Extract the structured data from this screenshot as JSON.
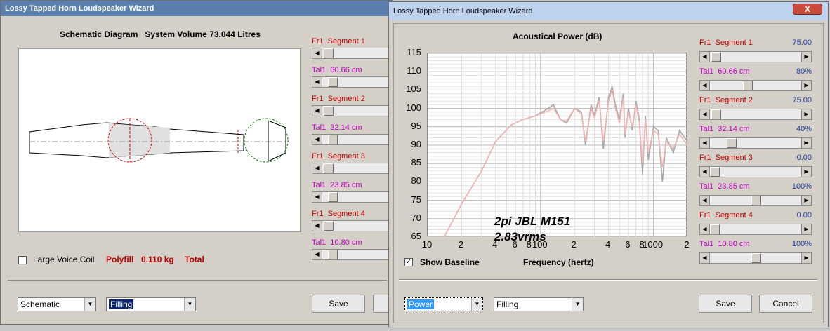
{
  "back": {
    "title": "Lossy Tapped Horn Loudspeaker Wizard",
    "schematic_heading": "Schematic Diagram   System Volume 73.044 Litres",
    "sliders": [
      {
        "label": "Fr1  Segment 1",
        "kind": "red"
      },
      {
        "label": "Tal1  60.66 cm",
        "kind": "mag"
      },
      {
        "label": "Fr1  Segment 2",
        "kind": "red"
      },
      {
        "label": "Tal1  32.14 cm",
        "kind": "mag"
      },
      {
        "label": "Fr1  Segment 3",
        "kind": "red"
      },
      {
        "label": "Tal1  23.85 cm",
        "kind": "mag"
      },
      {
        "label": "Fr1  Segment 4",
        "kind": "red"
      },
      {
        "label": "Tal1  10.80 cm",
        "kind": "mag"
      }
    ],
    "large_voice_coil": "Large Voice Coil",
    "polyfill": "Polyfill",
    "polyfill_value": "0.110 kg",
    "total": "Total",
    "select1": "Schematic",
    "select2": "Filling",
    "save": "Save"
  },
  "front": {
    "title": "Lossy Tapped Horn Loudspeaker Wizard",
    "close_symbol": "X",
    "sliders": [
      {
        "label": "Fr1  Segment 1",
        "value": "75.00",
        "kind": "red",
        "fraction": 0.02
      },
      {
        "label": "Tal1  60.66 cm",
        "value": "80%",
        "kind": "mag",
        "fraction": 0.4
      },
      {
        "label": "Fr1  Segment 2",
        "value": "75.00",
        "kind": "red",
        "fraction": 0.02
      },
      {
        "label": "Tal1  32.14 cm",
        "value": "40%",
        "kind": "mag",
        "fraction": 0.2
      },
      {
        "label": "Fr1  Segment 3",
        "value": "0.00",
        "kind": "red",
        "fraction": 0.0
      },
      {
        "label": "Tal1  23.85 cm",
        "value": "100%",
        "kind": "mag",
        "fraction": 0.5
      },
      {
        "label": "Fr1  Segment 4",
        "value": "0.00",
        "kind": "red",
        "fraction": 0.0
      },
      {
        "label": "Tal1  10.80 cm",
        "value": "100%",
        "kind": "mag",
        "fraction": 0.5
      }
    ],
    "show_baseline": "Show Baseline",
    "show_baseline_checked": true,
    "select1": "Power",
    "select2": "Filling",
    "save": "Save",
    "cancel": "Cancel"
  },
  "chart_data": {
    "type": "line",
    "title": "Acoustical Power (dB)",
    "xlabel": "Frequency (hertz)",
    "ylabel": "",
    "ylim": [
      65,
      115
    ],
    "xscale": "log",
    "xlim": [
      10,
      2000
    ],
    "y_ticks": [
      "115",
      "110",
      "105",
      "100",
      "95",
      "90",
      "85",
      "80",
      "75",
      "70",
      "65"
    ],
    "x_ticks": [
      {
        "label": "10",
        "value": 10
      },
      {
        "label": "2",
        "value": 20
      },
      {
        "label": "4",
        "value": 40
      },
      {
        "label": "6",
        "value": 60
      },
      {
        "label": "8",
        "value": 80
      },
      {
        "label": "100",
        "value": 100
      },
      {
        "label": "2",
        "value": 200
      },
      {
        "label": "4",
        "value": 400
      },
      {
        "label": "6",
        "value": 600
      },
      {
        "label": "8",
        "value": 800
      },
      {
        "label": "1000",
        "value": 1000
      },
      {
        "label": "2",
        "value": 2000
      }
    ],
    "annotations": [
      "2pi JBL M151",
      "2.83vrms"
    ],
    "grid": true,
    "series": [
      {
        "color": "#a8a8a8",
        "x": [
          14,
          20,
          30,
          40,
          55,
          70,
          90,
          110,
          130,
          150,
          170,
          200,
          230,
          250,
          280,
          300,
          330,
          360,
          400,
          430,
          460,
          500,
          540,
          560,
          600,
          650,
          700,
          750,
          800,
          850,
          900,
          1000,
          1100,
          1200,
          1300,
          1500,
          1700,
          2000
        ],
        "y": [
          65,
          74,
          83,
          91,
          95.5,
          97,
          98,
          99.5,
          101,
          97,
          96,
          100,
          99,
          90,
          101,
          98,
          103,
          89,
          103,
          106,
          101,
          97,
          104,
          92,
          100,
          94,
          102,
          97,
          82,
          98,
          86,
          95,
          94,
          80,
          92,
          88,
          94,
          91
        ]
      },
      {
        "color": "#f2b4b4",
        "x": [
          14,
          20,
          30,
          40,
          55,
          70,
          90,
          110,
          130,
          150,
          170,
          200,
          230,
          250,
          280,
          300,
          330,
          360,
          400,
          430,
          460,
          500,
          540,
          560,
          600,
          650,
          700,
          750,
          800,
          850,
          900,
          1000,
          1100,
          1200,
          1300,
          1500,
          1700,
          2000
        ],
        "y": [
          65,
          74,
          83,
          91,
          95.5,
          97,
          98,
          99,
          100,
          97,
          96.5,
          100,
          98.5,
          91,
          100,
          97.5,
          102,
          91,
          102,
          105,
          100,
          96,
          103,
          93,
          99,
          95,
          101,
          96,
          85,
          97,
          88,
          94,
          93,
          84,
          91,
          89,
          93,
          90
        ]
      }
    ]
  }
}
